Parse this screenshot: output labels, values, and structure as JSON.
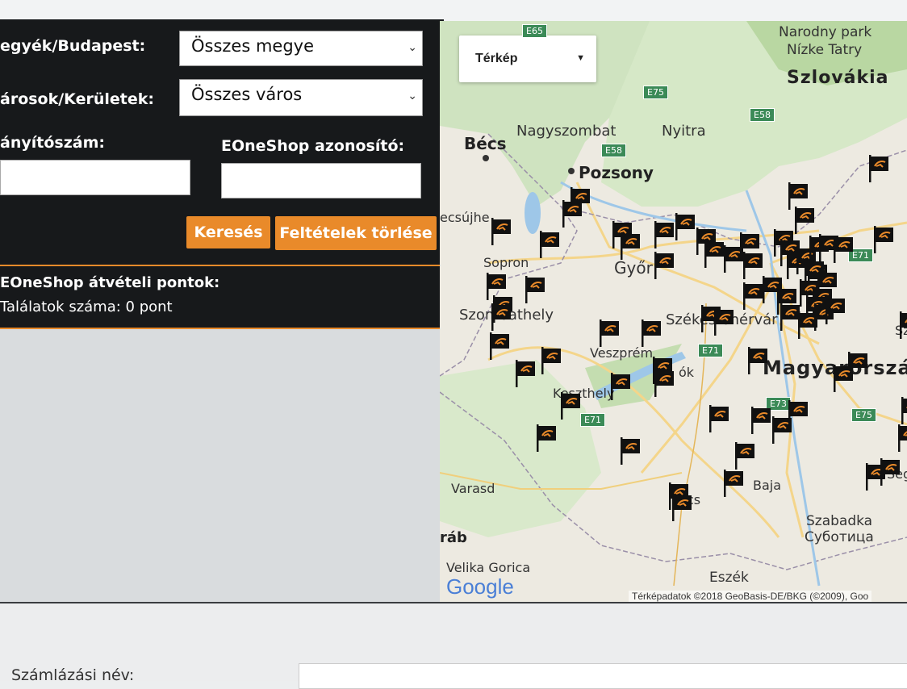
{
  "form": {
    "county_label": "egyék/Budapest:",
    "county_value": "Összes megye",
    "city_label": "árosok/Kerületek:",
    "city_value": "Összes város",
    "zip_label": "ányítószám:",
    "zip_value": "",
    "shopid_label": "EOneShop azonosító:",
    "shopid_value": "",
    "search_button": "Keresés",
    "clear_button": "Feltételek törlése"
  },
  "results": {
    "heading": "EOneShop átvételi pontok:",
    "count": "Találatok száma: 0 pont"
  },
  "map": {
    "type_selector": "Térkép",
    "labels": {
      "np1": "Narodny park",
      "np2": "Nízke Tatry",
      "slovakia": "Szlovákia",
      "becs": "Bécs",
      "nagyszombat": "Nagyszombat",
      "nyitra": "Nyitra",
      "pozsony": "Pozsony",
      "becsujhely": "ecsújhe",
      "sopron": "Sopron",
      "gyor": "Győr",
      "szombathely": "Szombathely",
      "szekesfehervar": "Székesfehérvár",
      "veszprem": "Veszprém",
      "keszthely": "Keszthely",
      "tok": "ók",
      "magyarorszag": "Magyarország",
      "varasd": "Varasd",
      "baja": "Baja",
      "szabadka1": "Szabadka",
      "szabadka2": "Суботица",
      "zagrab": "ráb",
      "velika": "Velika Gorica",
      "eszek": "Eszék",
      "pecs": "cs",
      "s_edge": "Sz",
      "seg": "Seg"
    },
    "roads": [
      "E65",
      "E75",
      "E58",
      "E58",
      "E71",
      "E71",
      "E71",
      "E75",
      "E73"
    ],
    "google": "Google",
    "attribution": "Térképadatok ©2018 GeoBasis-DE/BKG (©2009), Goo"
  },
  "billing": {
    "label": "Számlázási név:"
  },
  "colors": {
    "accent": "#e98a2a",
    "panel": "#17191b",
    "map_bg": "#edeae1",
    "marker": "#111111"
  }
}
